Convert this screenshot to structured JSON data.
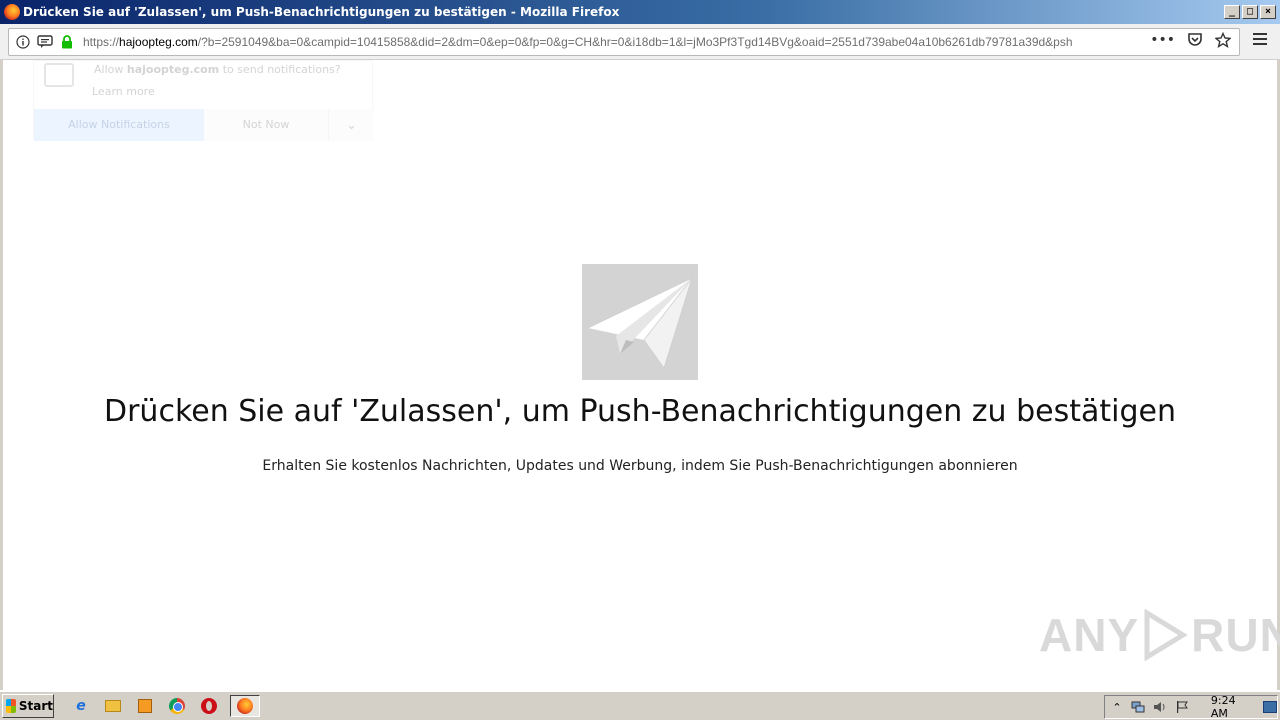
{
  "window": {
    "title": "Drücken Sie auf 'Zulassen', um Push-Benachrichtigungen zu bestätigen - Mozilla Firefox",
    "min_symbol": "_",
    "max_symbol": "□",
    "close_symbol": "×"
  },
  "navbar": {
    "url_scheme": "https://",
    "url_host": "hajoopteg.com",
    "url_rest": "/?b=2591049&ba=0&campid=10415858&did=2&dm=0&ep=0&fp=0&g=CH&hr=0&i18db=1&l=jMo3Pf3Tgd14BVg&oaid=2551d739abe04a10b6261db79781a39d&psh",
    "more_label": "•••",
    "icons": [
      "info-icon",
      "message-icon",
      "lock-icon",
      "pocket-icon",
      "bookmark-star-icon",
      "hamburger-menu-icon"
    ]
  },
  "popup": {
    "text_prefix": "Allow",
    "text_host": "hajoopteg.com",
    "text_suffix": "to send notifications?",
    "learn_more": "Learn more",
    "allow_label": "Allow Notifications",
    "deny_label": "Not Now",
    "more_symbol": "⌄"
  },
  "page": {
    "headline": "Drücken Sie auf 'Zulassen', um Push-Benachrichtigungen zu bestätigen",
    "subline": "Erhalten Sie kostenlos Nachrichten, Updates und Werbung, indem Sie Push-Benachrichtigungen abonnieren",
    "watermark_left": "ANY",
    "watermark_right": "RUN"
  },
  "taskbar": {
    "start_label": "Start",
    "ie_glyph": "e",
    "clock": "9:24 AM",
    "tray_up": "⌃"
  }
}
